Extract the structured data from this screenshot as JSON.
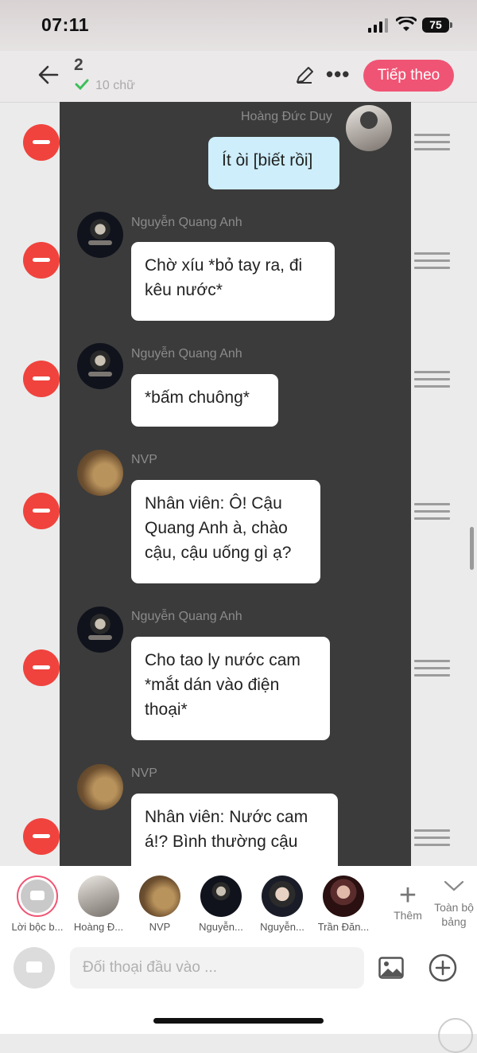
{
  "status_bar": {
    "time": "07:11",
    "battery": "75"
  },
  "header": {
    "count": "2",
    "sub": "10 chữ",
    "next_label": "Tiếp theo"
  },
  "messages": [
    {
      "speaker": "Hoàng Đức Duy",
      "text": "Ít òi [biết rồi]",
      "side": "right"
    },
    {
      "speaker": "Nguyễn Quang Anh",
      "text": "Chờ xíu *bỏ tay ra, đi kêu nước*",
      "side": "left"
    },
    {
      "speaker": "Nguyễn Quang Anh",
      "text": "*bấm chuông*",
      "side": "left"
    },
    {
      "speaker": "NVP",
      "text": "Nhân viên: Ô! Cậu Quang Anh à, chào cậu, cậu uống gì ạ?",
      "side": "left"
    },
    {
      "speaker": "Nguyễn Quang Anh",
      "text": "Cho tao ly nước cam *mắt dán vào điện thoại*",
      "side": "left"
    },
    {
      "speaker": "NVP",
      "text": "Nhân viên: Nước cam á!? Bình thường cậu",
      "side": "left"
    }
  ],
  "characters": [
    {
      "label": "Lời bộc b..."
    },
    {
      "label": "Hoàng Đ..."
    },
    {
      "label": "NVP"
    },
    {
      "label": "Nguyễn..."
    },
    {
      "label": "Nguyễn..."
    },
    {
      "label": "Trần Đăn..."
    }
  ],
  "more_label": "Thêm",
  "full_board_label": "Toàn bộ bảng",
  "input": {
    "placeholder": "Đối thoại đầu vào ..."
  },
  "colors": {
    "accent": "#f05474",
    "delete": "#f0433d",
    "chat_bg": "#3b3b3b",
    "my_bubble": "#cdeefa"
  }
}
